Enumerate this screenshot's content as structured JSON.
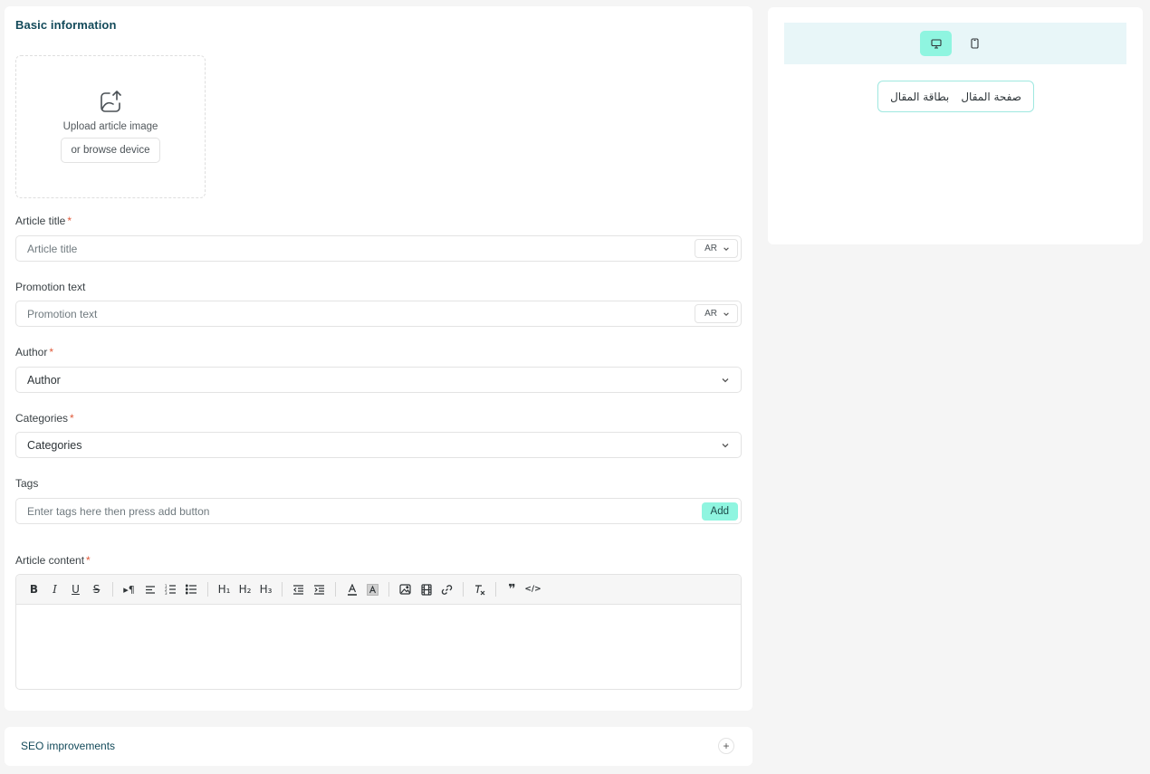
{
  "basic_info": {
    "title": "Basic information",
    "upload": {
      "text": "Upload article image",
      "browse_label": "or browse device"
    }
  },
  "fields": {
    "article_title": {
      "label": "Article title",
      "required_mark": "*",
      "placeholder": "Article title",
      "lang": "AR"
    },
    "promotion_text": {
      "label": "Promotion text",
      "placeholder": "Promotion text",
      "lang": "AR"
    },
    "author": {
      "label": "Author",
      "required_mark": "*",
      "value": "Author"
    },
    "categories": {
      "label": "Categories",
      "required_mark": "*",
      "value": "Categories"
    },
    "tags": {
      "label": "Tags",
      "placeholder": "Enter tags here then press add button",
      "add_label": "Add"
    },
    "content": {
      "label": "Article content",
      "required_mark": "*"
    }
  },
  "editor": {
    "toolbar": {
      "bold": "B",
      "italic": "I",
      "underline": "U",
      "strike": "S",
      "direction": "▸¶",
      "h1": "H₁",
      "h2": "H₂",
      "h3": "H₃",
      "quote": "❞",
      "code": "</>",
      "clear": "T̷ₓ"
    }
  },
  "preview": {
    "tabs": [
      "صفحة المقال",
      "بطاقة المقال"
    ],
    "devices": [
      {
        "icon": "desktop-icon",
        "active": true
      },
      {
        "icon": "mobile-icon",
        "active": false
      }
    ]
  },
  "seo": {
    "title": "SEO improvements",
    "toggle": "+"
  },
  "colors": {
    "accent": "#8ff5e0",
    "heading": "#134a5a",
    "required": "#e05a3a",
    "preview_bar": "#e8f6f8"
  }
}
